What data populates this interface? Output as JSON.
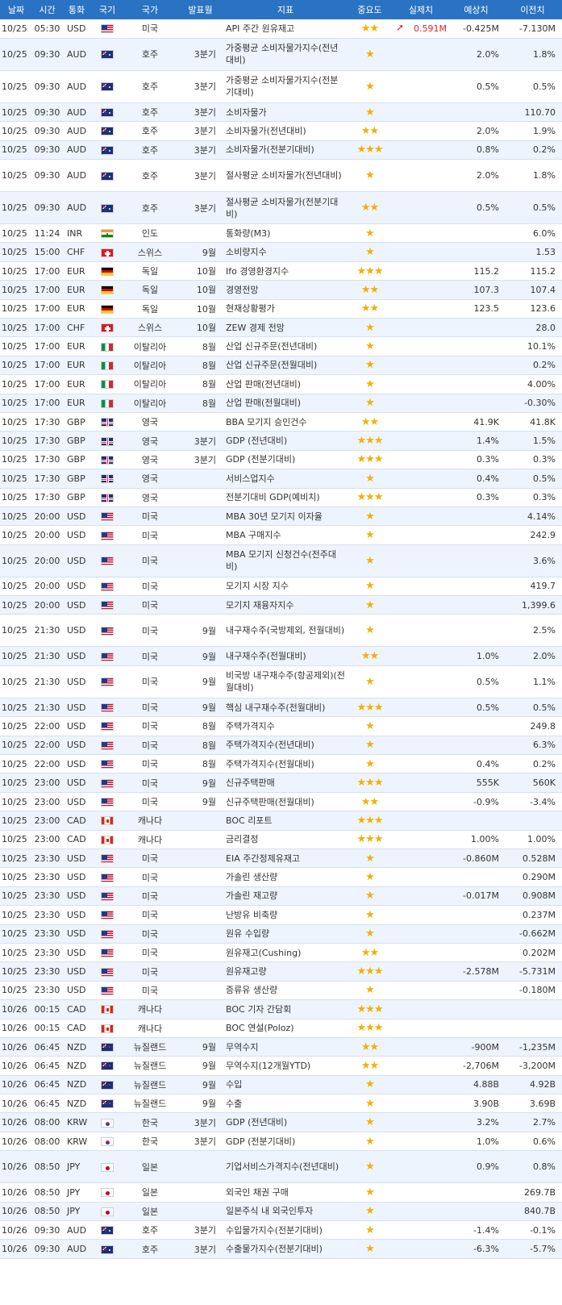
{
  "columns": [
    "날짜",
    "시간",
    "통화",
    "국기",
    "국가",
    "발표월",
    "지표",
    "중요도",
    "실제치",
    "예상치",
    "이전치"
  ],
  "rows": [
    {
      "date": "10/25",
      "time": "05:30",
      "cur": "USD",
      "flag": "us",
      "country": "미국",
      "period": "",
      "ind": "API 주간 원유재고",
      "imp": "★★",
      "act": "0.591M",
      "act_arrow": "up",
      "fc": "-0.425M",
      "prev": "-7.130M",
      "tall": false
    },
    {
      "date": "10/25",
      "time": "09:30",
      "cur": "AUD",
      "flag": "au",
      "country": "호주",
      "period": "3분기",
      "ind": "가중평균 소비자물가지수(전년대비)",
      "imp": "★",
      "act": "",
      "fc": "2.0%",
      "prev": "1.8%",
      "tall": true
    },
    {
      "date": "10/25",
      "time": "09:30",
      "cur": "AUD",
      "flag": "au",
      "country": "호주",
      "period": "3분기",
      "ind": "가중평균 소비자물가지수(전분기대비)",
      "imp": "★",
      "act": "",
      "fc": "0.5%",
      "prev": "0.5%",
      "tall": true
    },
    {
      "date": "10/25",
      "time": "09:30",
      "cur": "AUD",
      "flag": "au",
      "country": "호주",
      "period": "3분기",
      "ind": "소비자물가",
      "imp": "★",
      "act": "",
      "fc": "",
      "prev": "110.70",
      "tall": false
    },
    {
      "date": "10/25",
      "time": "09:30",
      "cur": "AUD",
      "flag": "au",
      "country": "호주",
      "period": "3분기",
      "ind": "소비자물가(전년대비)",
      "imp": "★★",
      "act": "",
      "fc": "2.0%",
      "prev": "1.9%",
      "tall": false
    },
    {
      "date": "10/25",
      "time": "09:30",
      "cur": "AUD",
      "flag": "au",
      "country": "호주",
      "period": "3분기",
      "ind": "소비자물가(전분기대비)",
      "imp": "★★★",
      "act": "",
      "fc": "0.8%",
      "prev": "0.2%",
      "tall": false
    },
    {
      "date": "10/25",
      "time": "09:30",
      "cur": "AUD",
      "flag": "au",
      "country": "호주",
      "period": "3분기",
      "ind": "절사평균 소비자물가(전년대비)",
      "imp": "★",
      "act": "",
      "fc": "2.0%",
      "prev": "1.8%",
      "tall": true
    },
    {
      "date": "10/25",
      "time": "09:30",
      "cur": "AUD",
      "flag": "au",
      "country": "호주",
      "period": "3분기",
      "ind": "절사평균 소비자물가(전분기대비)",
      "imp": "★★",
      "act": "",
      "fc": "0.5%",
      "prev": "0.5%",
      "tall": true
    },
    {
      "date": "10/25",
      "time": "11:24",
      "cur": "INR",
      "flag": "in",
      "country": "인도",
      "period": "",
      "ind": "통화량(M3)",
      "imp": "★",
      "act": "",
      "fc": "",
      "prev": "6.0%",
      "tall": false
    },
    {
      "date": "10/25",
      "time": "15:00",
      "cur": "CHF",
      "flag": "ch",
      "country": "스위스",
      "period": "9월",
      "ind": "소비량지수",
      "imp": "★",
      "act": "",
      "fc": "",
      "prev": "1.53",
      "tall": false
    },
    {
      "date": "10/25",
      "time": "17:00",
      "cur": "EUR",
      "flag": "de",
      "country": "독일",
      "period": "10월",
      "ind": "Ifo 경영환경지수",
      "imp": "★★★",
      "act": "",
      "fc": "115.2",
      "prev": "115.2",
      "tall": false
    },
    {
      "date": "10/25",
      "time": "17:00",
      "cur": "EUR",
      "flag": "de",
      "country": "독일",
      "period": "10월",
      "ind": "경영전망",
      "imp": "★★",
      "act": "",
      "fc": "107.3",
      "prev": "107.4",
      "tall": false
    },
    {
      "date": "10/25",
      "time": "17:00",
      "cur": "EUR",
      "flag": "de",
      "country": "독일",
      "period": "10월",
      "ind": "현재상황평가",
      "imp": "★★",
      "act": "",
      "fc": "123.5",
      "prev": "123.6",
      "tall": false
    },
    {
      "date": "10/25",
      "time": "17:00",
      "cur": "CHF",
      "flag": "ch",
      "country": "스위스",
      "period": "10월",
      "ind": "ZEW 경제 전망",
      "imp": "★",
      "act": "",
      "fc": "",
      "prev": "28.0",
      "tall": false
    },
    {
      "date": "10/25",
      "time": "17:00",
      "cur": "EUR",
      "flag": "it",
      "country": "이탈리아",
      "period": "8월",
      "ind": "산업 신규주문(전년대비)",
      "imp": "★",
      "act": "",
      "fc": "",
      "prev": "10.1%",
      "tall": false
    },
    {
      "date": "10/25",
      "time": "17:00",
      "cur": "EUR",
      "flag": "it",
      "country": "이탈리아",
      "period": "8월",
      "ind": "산업 신규주문(전월대비)",
      "imp": "★",
      "act": "",
      "fc": "",
      "prev": "0.2%",
      "tall": false
    },
    {
      "date": "10/25",
      "time": "17:00",
      "cur": "EUR",
      "flag": "it",
      "country": "이탈리아",
      "period": "8월",
      "ind": "산업 판매(전년대비)",
      "imp": "★",
      "act": "",
      "fc": "",
      "prev": "4.00%",
      "tall": false
    },
    {
      "date": "10/25",
      "time": "17:00",
      "cur": "EUR",
      "flag": "it",
      "country": "이탈리아",
      "period": "8월",
      "ind": "산업 판매(전월대비)",
      "imp": "★",
      "act": "",
      "fc": "",
      "prev": "-0.30%",
      "tall": false
    },
    {
      "date": "10/25",
      "time": "17:30",
      "cur": "GBP",
      "flag": "gb",
      "country": "영국",
      "period": "",
      "ind": "BBA 모기지 승인건수",
      "imp": "★★",
      "act": "",
      "fc": "41.9K",
      "prev": "41.8K",
      "tall": false
    },
    {
      "date": "10/25",
      "time": "17:30",
      "cur": "GBP",
      "flag": "gb",
      "country": "영국",
      "period": "3분기",
      "ind": "GDP (전년대비)",
      "imp": "★★★",
      "act": "",
      "fc": "1.4%",
      "prev": "1.5%",
      "tall": false
    },
    {
      "date": "10/25",
      "time": "17:30",
      "cur": "GBP",
      "flag": "gb",
      "country": "영국",
      "period": "3분기",
      "ind": "GDP (전분기대비)",
      "imp": "★★★",
      "act": "",
      "fc": "0.3%",
      "prev": "0.3%",
      "tall": false
    },
    {
      "date": "10/25",
      "time": "17:30",
      "cur": "GBP",
      "flag": "gb",
      "country": "영국",
      "period": "",
      "ind": "서비스업지수",
      "imp": "★",
      "act": "",
      "fc": "0.4%",
      "prev": "0.5%",
      "tall": false
    },
    {
      "date": "10/25",
      "time": "17:30",
      "cur": "GBP",
      "flag": "gb",
      "country": "영국",
      "period": "",
      "ind": "전분기대비 GDP(예비치)",
      "imp": "★★★",
      "act": "",
      "fc": "0.3%",
      "prev": "0.3%",
      "tall": false
    },
    {
      "date": "10/25",
      "time": "20:00",
      "cur": "USD",
      "flag": "us",
      "country": "미국",
      "period": "",
      "ind": "MBA 30년 모기지 이자율",
      "imp": "★",
      "act": "",
      "fc": "",
      "prev": "4.14%",
      "tall": false
    },
    {
      "date": "10/25",
      "time": "20:00",
      "cur": "USD",
      "flag": "us",
      "country": "미국",
      "period": "",
      "ind": "MBA 구매지수",
      "imp": "★",
      "act": "",
      "fc": "",
      "prev": "242.9",
      "tall": false
    },
    {
      "date": "10/25",
      "time": "20:00",
      "cur": "USD",
      "flag": "us",
      "country": "미국",
      "period": "",
      "ind": "MBA 모기지 신청건수(전주대비)",
      "imp": "★",
      "act": "",
      "fc": "",
      "prev": "3.6%",
      "tall": true
    },
    {
      "date": "10/25",
      "time": "20:00",
      "cur": "USD",
      "flag": "us",
      "country": "미국",
      "period": "",
      "ind": "모기지 시장 지수",
      "imp": "★",
      "act": "",
      "fc": "",
      "prev": "419.7",
      "tall": false
    },
    {
      "date": "10/25",
      "time": "20:00",
      "cur": "USD",
      "flag": "us",
      "country": "미국",
      "period": "",
      "ind": "모기지 재융자지수",
      "imp": "★",
      "act": "",
      "fc": "",
      "prev": "1,399.6",
      "tall": false
    },
    {
      "date": "10/25",
      "time": "21:30",
      "cur": "USD",
      "flag": "us",
      "country": "미국",
      "period": "9월",
      "ind": "내구재수주(국방제외, 전월대비)",
      "imp": "★",
      "act": "",
      "fc": "",
      "prev": "2.5%",
      "tall": true
    },
    {
      "date": "10/25",
      "time": "21:30",
      "cur": "USD",
      "flag": "us",
      "country": "미국",
      "period": "9월",
      "ind": "내구재수주(전월대비)",
      "imp": "★★",
      "act": "",
      "fc": "1.0%",
      "prev": "2.0%",
      "tall": false
    },
    {
      "date": "10/25",
      "time": "21:30",
      "cur": "USD",
      "flag": "us",
      "country": "미국",
      "period": "9월",
      "ind": "비국방 내구재수주(항공제외)(전월대비)",
      "imp": "★",
      "act": "",
      "fc": "0.5%",
      "prev": "1.1%",
      "tall": true
    },
    {
      "date": "10/25",
      "time": "21:30",
      "cur": "USD",
      "flag": "us",
      "country": "미국",
      "period": "9월",
      "ind": "핵심 내구재수주(전월대비)",
      "imp": "★★★",
      "act": "",
      "fc": "0.5%",
      "prev": "0.5%",
      "tall": false
    },
    {
      "date": "10/25",
      "time": "22:00",
      "cur": "USD",
      "flag": "us",
      "country": "미국",
      "period": "8월",
      "ind": "주택가격지수",
      "imp": "★",
      "act": "",
      "fc": "",
      "prev": "249.8",
      "tall": false
    },
    {
      "date": "10/25",
      "time": "22:00",
      "cur": "USD",
      "flag": "us",
      "country": "미국",
      "period": "8월",
      "ind": "주택가격지수(전년대비)",
      "imp": "★",
      "act": "",
      "fc": "",
      "prev": "6.3%",
      "tall": false
    },
    {
      "date": "10/25",
      "time": "22:00",
      "cur": "USD",
      "flag": "us",
      "country": "미국",
      "period": "8월",
      "ind": "주택가격지수(전월대비)",
      "imp": "★",
      "act": "",
      "fc": "0.4%",
      "prev": "0.2%",
      "tall": false
    },
    {
      "date": "10/25",
      "time": "23:00",
      "cur": "USD",
      "flag": "us",
      "country": "미국",
      "period": "9월",
      "ind": "신규주택판매",
      "imp": "★★★",
      "act": "",
      "fc": "555K",
      "prev": "560K",
      "tall": false
    },
    {
      "date": "10/25",
      "time": "23:00",
      "cur": "USD",
      "flag": "us",
      "country": "미국",
      "period": "9월",
      "ind": "신규주택판매(전월대비)",
      "imp": "★★",
      "act": "",
      "fc": "-0.9%",
      "prev": "-3.4%",
      "tall": false
    },
    {
      "date": "10/25",
      "time": "23:00",
      "cur": "CAD",
      "flag": "ca",
      "country": "캐나다",
      "period": "",
      "ind": "BOC 리포트",
      "imp": "★★★",
      "act": "",
      "fc": "",
      "prev": "",
      "tall": false
    },
    {
      "date": "10/25",
      "time": "23:00",
      "cur": "CAD",
      "flag": "ca",
      "country": "캐나다",
      "period": "",
      "ind": "금리결정",
      "imp": "★★★",
      "act": "",
      "fc": "1.00%",
      "prev": "1.00%",
      "tall": false
    },
    {
      "date": "10/25",
      "time": "23:30",
      "cur": "USD",
      "flag": "us",
      "country": "미국",
      "period": "",
      "ind": "EIA 주간정제유재고",
      "imp": "★",
      "act": "",
      "fc": "-0.860M",
      "prev": "0.528M",
      "tall": false
    },
    {
      "date": "10/25",
      "time": "23:30",
      "cur": "USD",
      "flag": "us",
      "country": "미국",
      "period": "",
      "ind": "가솔린 생산량",
      "imp": "★",
      "act": "",
      "fc": "",
      "prev": "0.290M",
      "tall": false
    },
    {
      "date": "10/25",
      "time": "23:30",
      "cur": "USD",
      "flag": "us",
      "country": "미국",
      "period": "",
      "ind": "가솔린 재고량",
      "imp": "★",
      "act": "",
      "fc": "-0.017M",
      "prev": "0.908M",
      "tall": false
    },
    {
      "date": "10/25",
      "time": "23:30",
      "cur": "USD",
      "flag": "us",
      "country": "미국",
      "period": "",
      "ind": "난방유 비축량",
      "imp": "★",
      "act": "",
      "fc": "",
      "prev": "0.237M",
      "tall": false
    },
    {
      "date": "10/25",
      "time": "23:30",
      "cur": "USD",
      "flag": "us",
      "country": "미국",
      "period": "",
      "ind": "원유 수입량",
      "imp": "★",
      "act": "",
      "fc": "",
      "prev": "-0.662M",
      "tall": false
    },
    {
      "date": "10/25",
      "time": "23:30",
      "cur": "USD",
      "flag": "us",
      "country": "미국",
      "period": "",
      "ind": "원유재고(Cushing)",
      "imp": "★★",
      "act": "",
      "fc": "",
      "prev": "0.202M",
      "tall": false
    },
    {
      "date": "10/25",
      "time": "23:30",
      "cur": "USD",
      "flag": "us",
      "country": "미국",
      "period": "",
      "ind": "원유재고량",
      "imp": "★★★",
      "act": "",
      "fc": "-2.578M",
      "prev": "-5.731M",
      "tall": false
    },
    {
      "date": "10/25",
      "time": "23:30",
      "cur": "USD",
      "flag": "us",
      "country": "미국",
      "period": "",
      "ind": "증류유 생산량",
      "imp": "★",
      "act": "",
      "fc": "",
      "prev": "-0.180M",
      "tall": false
    },
    {
      "date": "10/26",
      "time": "00:15",
      "cur": "CAD",
      "flag": "ca",
      "country": "캐나다",
      "period": "",
      "ind": "BOC 기자 간담회",
      "imp": "★★★",
      "act": "",
      "fc": "",
      "prev": "",
      "tall": false
    },
    {
      "date": "10/26",
      "time": "00:15",
      "cur": "CAD",
      "flag": "ca",
      "country": "캐나다",
      "period": "",
      "ind": "BOC 연설(Poloz)",
      "imp": "★★★",
      "act": "",
      "fc": "",
      "prev": "",
      "tall": false
    },
    {
      "date": "10/26",
      "time": "06:45",
      "cur": "NZD",
      "flag": "nz",
      "country": "뉴질랜드",
      "period": "9월",
      "ind": "무역수지",
      "imp": "★★",
      "act": "",
      "fc": "-900M",
      "prev": "-1,235M",
      "tall": false
    },
    {
      "date": "10/26",
      "time": "06:45",
      "cur": "NZD",
      "flag": "nz",
      "country": "뉴질랜드",
      "period": "9월",
      "ind": "무역수지(12개월YTD)",
      "imp": "★★",
      "act": "",
      "fc": "-2,706M",
      "prev": "-3,200M",
      "tall": false
    },
    {
      "date": "10/26",
      "time": "06:45",
      "cur": "NZD",
      "flag": "nz",
      "country": "뉴질랜드",
      "period": "9월",
      "ind": "수입",
      "imp": "★",
      "act": "",
      "fc": "4.88B",
      "prev": "4.92B",
      "tall": false
    },
    {
      "date": "10/26",
      "time": "06:45",
      "cur": "NZD",
      "flag": "nz",
      "country": "뉴질랜드",
      "period": "9월",
      "ind": "수출",
      "imp": "★",
      "act": "",
      "fc": "3.90B",
      "prev": "3.69B",
      "tall": false
    },
    {
      "date": "10/26",
      "time": "08:00",
      "cur": "KRW",
      "flag": "kr",
      "country": "한국",
      "period": "3분기",
      "ind": "GDP (전년대비)",
      "imp": "★",
      "act": "",
      "fc": "3.2%",
      "prev": "2.7%",
      "tall": false
    },
    {
      "date": "10/26",
      "time": "08:00",
      "cur": "KRW",
      "flag": "kr",
      "country": "한국",
      "period": "3분기",
      "ind": "GDP (전분기대비)",
      "imp": "★",
      "act": "",
      "fc": "1.0%",
      "prev": "0.6%",
      "tall": false
    },
    {
      "date": "10/26",
      "time": "08:50",
      "cur": "JPY",
      "flag": "jp",
      "country": "일본",
      "period": "",
      "ind": "기업서비스가격지수(전년대비)",
      "imp": "★",
      "act": "",
      "fc": "0.9%",
      "prev": "0.8%",
      "tall": true
    },
    {
      "date": "10/26",
      "time": "08:50",
      "cur": "JPY",
      "flag": "jp",
      "country": "일본",
      "period": "",
      "ind": "외국인 채권 구매",
      "imp": "★",
      "act": "",
      "fc": "",
      "prev": "269.7B",
      "tall": false
    },
    {
      "date": "10/26",
      "time": "08:50",
      "cur": "JPY",
      "flag": "jp",
      "country": "일본",
      "period": "",
      "ind": "일본주식 내 외국인투자",
      "imp": "★",
      "act": "",
      "fc": "",
      "prev": "840.7B",
      "tall": false
    },
    {
      "date": "10/26",
      "time": "09:30",
      "cur": "AUD",
      "flag": "au",
      "country": "호주",
      "period": "3분기",
      "ind": "수입물가지수(전분기대비)",
      "imp": "★",
      "act": "",
      "fc": "-1.4%",
      "prev": "-0.1%",
      "tall": false
    },
    {
      "date": "10/26",
      "time": "09:30",
      "cur": "AUD",
      "flag": "au",
      "country": "호주",
      "period": "3분기",
      "ind": "수출물가지수(전분기대비)",
      "imp": "★",
      "act": "",
      "fc": "-6.3%",
      "prev": "-5.7%",
      "tall": false
    }
  ]
}
